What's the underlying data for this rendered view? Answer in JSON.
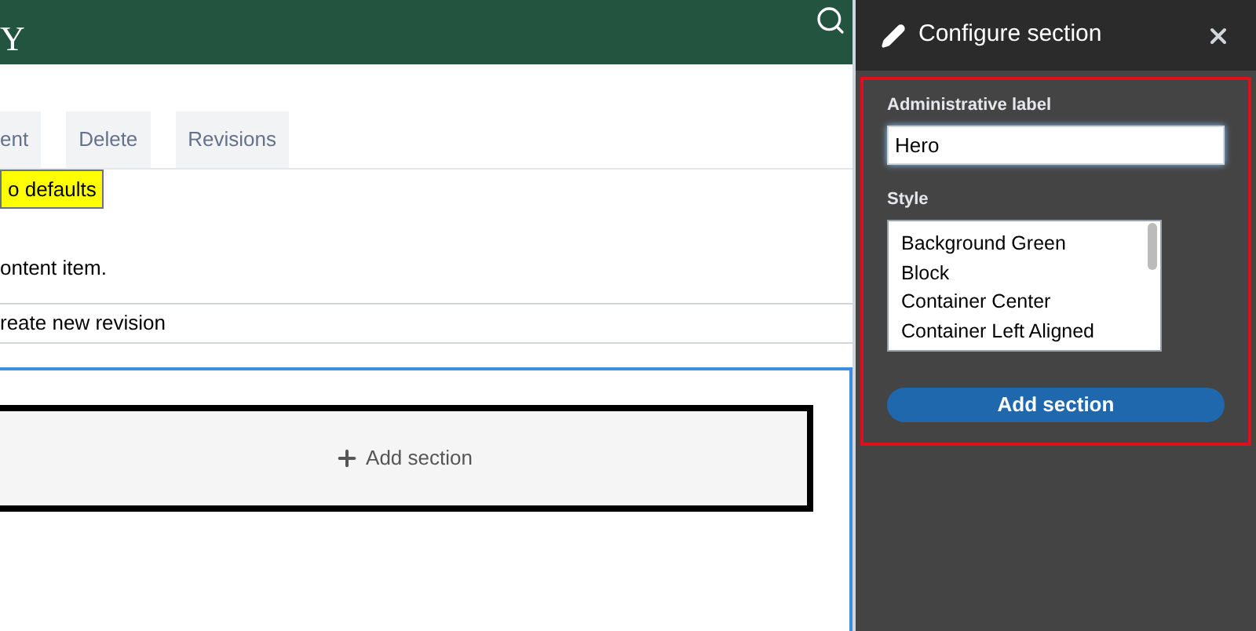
{
  "header": {
    "logo_text": "Y"
  },
  "tabs": [
    {
      "label": "ent",
      "selected": false
    },
    {
      "label": "Delete",
      "selected": false
    },
    {
      "label": "Revisions",
      "selected": false
    }
  ],
  "revert_button": "o defaults",
  "description": "ontent item.",
  "revision_checkbox_label": "reate new revision",
  "add_section_link": "Add section",
  "panel": {
    "title": "Configure section",
    "label_field": {
      "label": "Administrative label",
      "value": "Hero"
    },
    "style_field": {
      "label": "Style",
      "options": [
        "Background Green",
        "Block",
        "Container Center",
        "Container Left Aligned"
      ]
    },
    "submit": "Add section"
  }
}
